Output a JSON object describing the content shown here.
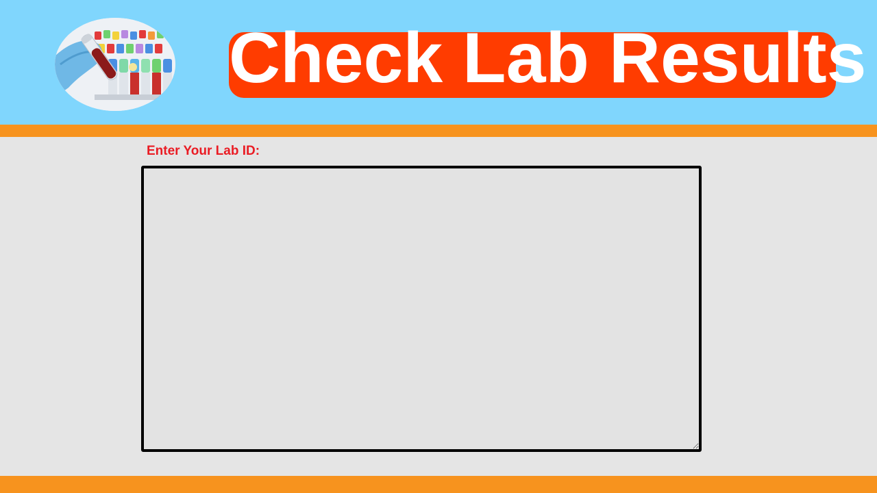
{
  "header": {
    "title": "Check Lab Results",
    "logo_icon": "blood-test-tubes-icon"
  },
  "form": {
    "lab_id_label": "Enter Your Lab ID:",
    "lab_id_value": "",
    "lab_id_placeholder": ""
  },
  "colors": {
    "header_background": "#80d6fd",
    "title_badge": "#ff3c00",
    "title_text": "#ffffff",
    "accent_stripe": "#f7931e",
    "label_text": "#ea1c24",
    "page_background": "#e5e5e5",
    "input_border": "#000000"
  }
}
